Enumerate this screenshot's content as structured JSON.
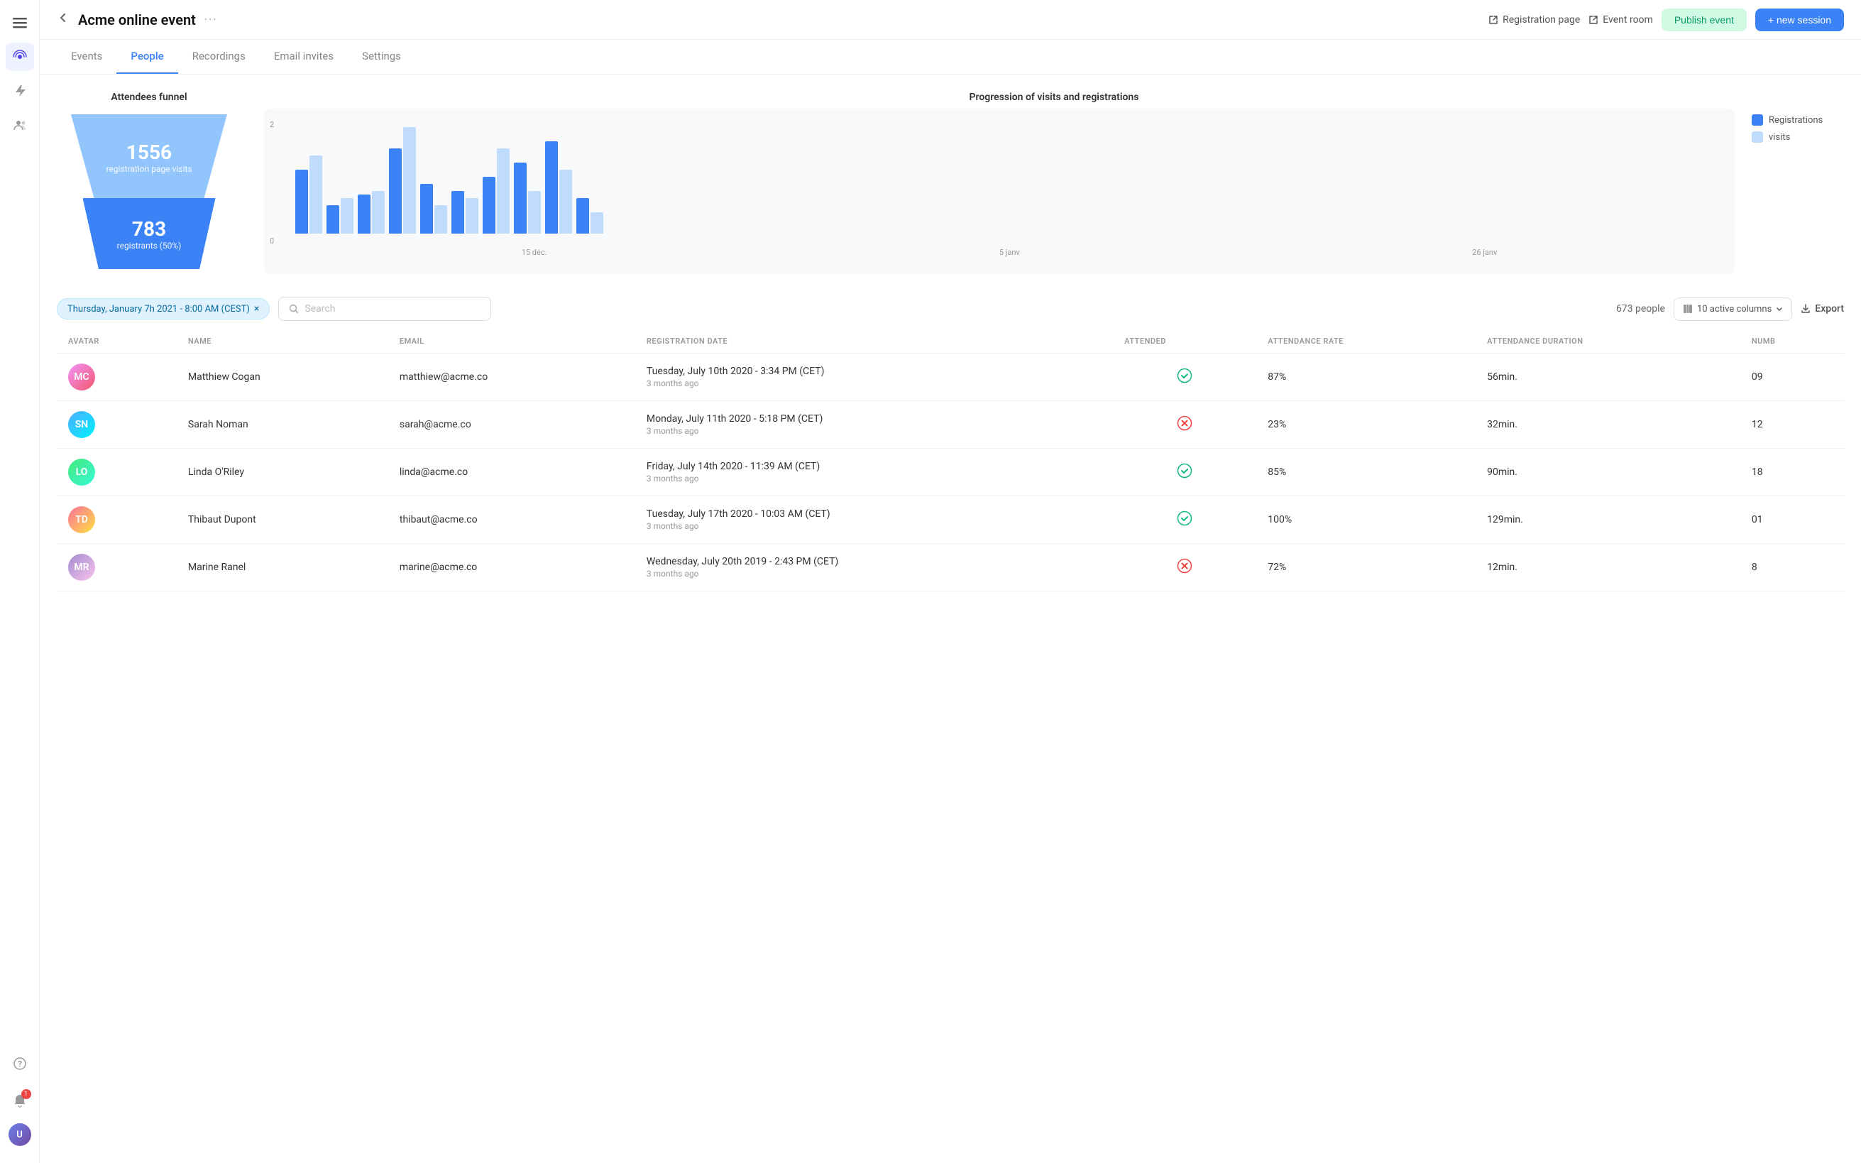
{
  "app": {
    "title": "Acme online event",
    "more_label": "···"
  },
  "header": {
    "registration_page_label": "Registration page",
    "event_room_label": "Event room",
    "publish_label": "Publish event",
    "new_session_label": "+ new session"
  },
  "tabs": [
    {
      "id": "events",
      "label": "Events",
      "active": false
    },
    {
      "id": "people",
      "label": "People",
      "active": true
    },
    {
      "id": "recordings",
      "label": "Recordings",
      "active": false
    },
    {
      "id": "email-invites",
      "label": "Email invites",
      "active": false
    },
    {
      "id": "settings",
      "label": "Settings",
      "active": false
    }
  ],
  "funnel": {
    "title": "Attendees funnel",
    "top_number": "1556",
    "top_label": "registration page visits",
    "bottom_number": "783",
    "bottom_label": "registrants (50%)"
  },
  "progression_chart": {
    "title": "Progression of visits and registrations",
    "y_max": "2",
    "y_min": "0",
    "x_labels": [
      "15 déc.",
      "5 janv",
      "26 janv"
    ],
    "legend": [
      {
        "label": "Registrations",
        "color": "#3b82f6"
      },
      {
        "label": "visits",
        "color": "#bfdbfe"
      }
    ],
    "bars": [
      {
        "registrations": 90,
        "visits": 110
      },
      {
        "registrations": 40,
        "visits": 50
      },
      {
        "registrations": 55,
        "visits": 60
      },
      {
        "registrations": 120,
        "visits": 150
      },
      {
        "registrations": 70,
        "visits": 40
      },
      {
        "registrations": 60,
        "visits": 50
      },
      {
        "registrations": 80,
        "visits": 120
      },
      {
        "registrations": 100,
        "visits": 60
      },
      {
        "registrations": 130,
        "visits": 90
      },
      {
        "registrations": 50,
        "visits": 30
      }
    ]
  },
  "table": {
    "filter_chip": "Thursday, January 7h 2021 - 8:00 AM (CEST)",
    "search_placeholder": "Search",
    "people_count": "673 people",
    "columns_label": "10 active columns",
    "export_label": "Export",
    "columns": [
      "AVATAR",
      "NAME",
      "EMAIL",
      "REGISTRATION DATE",
      "ATTENDED",
      "ATTENDANCE RATE",
      "ATTENDANCE DURATION",
      "NUMB"
    ],
    "rows": [
      {
        "avatar_class": "avatar1",
        "avatar_initials": "MC",
        "name": "Matthiew Cogan",
        "email": "matthiew@acme.co",
        "reg_date": "Tuesday, July 10th 2020 - 3:34 PM (CET)",
        "reg_ago": "3 months ago",
        "attended": true,
        "rate": "87%",
        "duration": "56min.",
        "num": "09"
      },
      {
        "avatar_class": "avatar2",
        "avatar_initials": "SN",
        "name": "Sarah Noman",
        "email": "sarah@acme.co",
        "reg_date": "Monday, July 11th 2020 - 5:18 PM (CET)",
        "reg_ago": "3 months ago",
        "attended": false,
        "rate": "23%",
        "duration": "32min.",
        "num": "12"
      },
      {
        "avatar_class": "avatar3",
        "avatar_initials": "LO",
        "name": "Linda O'Riley",
        "email": "linda@acme.co",
        "reg_date": "Friday, July 14th 2020 - 11:39 AM (CET)",
        "reg_ago": "3 months ago",
        "attended": true,
        "rate": "85%",
        "duration": "90min.",
        "num": "18"
      },
      {
        "avatar_class": "avatar4",
        "avatar_initials": "TD",
        "name": "Thibaut Dupont",
        "email": "thibaut@acme.co",
        "reg_date": "Tuesday, July 17th 2020 - 10:03 AM (CET)",
        "reg_ago": "3 months ago",
        "attended": true,
        "rate": "100%",
        "duration": "129min.",
        "num": "01"
      },
      {
        "avatar_class": "avatar5",
        "avatar_initials": "MR",
        "name": "Marine Ranel",
        "email": "marine@acme.co",
        "reg_date": "Wednesday, July 20th 2019 - 2:43 PM (CET)",
        "reg_ago": "3 months ago",
        "attended": false,
        "rate": "72%",
        "duration": "12min.",
        "num": "8"
      }
    ]
  },
  "sidebar": {
    "icons": [
      {
        "name": "menu-icon",
        "symbol": "☰"
      },
      {
        "name": "broadcast-icon",
        "symbol": "📡",
        "active": true
      },
      {
        "name": "lightning-icon",
        "symbol": "⚡"
      },
      {
        "name": "people-icon",
        "symbol": "👥"
      }
    ],
    "bottom_icons": [
      {
        "name": "help-icon",
        "symbol": "?"
      },
      {
        "name": "notification-icon",
        "symbol": "🔔",
        "badge": "1"
      }
    ]
  }
}
